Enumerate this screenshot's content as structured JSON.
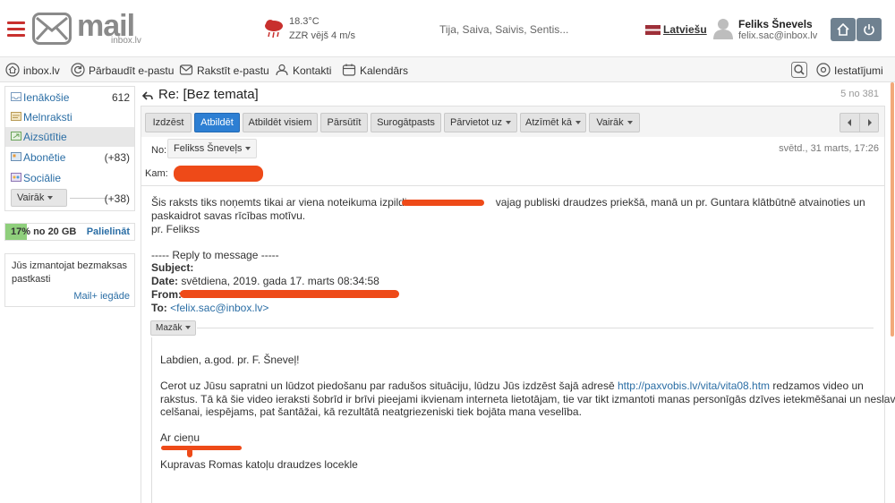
{
  "header": {
    "logo_text": "mail",
    "logo_sub": "inbox.lv",
    "weather_temp": "18.3°C",
    "weather_wind": "ZZR vējš 4 m/s",
    "namedays": "Tija, Saiva, Saivis, Sentis...",
    "language": "Latviešu",
    "user_name": "Feliks Šnevels",
    "user_email": "felix.sac@inbox.lv",
    "brand_color": "#c8302e"
  },
  "nav": {
    "items": [
      {
        "label": "inbox.lv",
        "icon": "home-icon"
      },
      {
        "label": "Pārbaudīt e-pastu",
        "icon": "refresh-icon"
      },
      {
        "label": "Rakstīt e-pastu",
        "icon": "compose-icon"
      },
      {
        "label": "Kontakti",
        "icon": "contacts-icon"
      },
      {
        "label": "Kalendārs",
        "icon": "calendar-icon"
      }
    ],
    "settings_label": "Iestatījumi"
  },
  "sidebar": {
    "folders": [
      {
        "name": "Ienākošie",
        "count": "612"
      },
      {
        "name": "Melnraksti",
        "count": ""
      },
      {
        "name": "Aizsūtītie",
        "count": ""
      },
      {
        "name": "Abonētie",
        "count": "(+83)"
      },
      {
        "name": "Sociālie",
        "count": ""
      }
    ],
    "more_label": "Vairāk",
    "more_count": "(+38)",
    "storage_text": "17% no 20 GB",
    "storage_percent": 17,
    "storage_link": "Palielināt",
    "promo_text": "Jūs izmantojat bezmaksas pastkasti",
    "promo_link": "Mail+ iegāde"
  },
  "message": {
    "subject": "Re: [Bez temata]",
    "counter": "5 no 381",
    "toolbar": {
      "delete": "Izdzēst",
      "reply": "Atbildēt",
      "reply_all": "Atbildēt visiem",
      "forward": "Pārsūtīt",
      "spam": "Surogātpasts",
      "move": "Pārvietot uz",
      "mark": "Atzīmēt kā",
      "more": "Vairāk"
    },
    "from_label": "No:",
    "from_name": "Felikss Šneveļs",
    "to_label": "Kam:",
    "date": "svētd., 31 marts, 17:26",
    "body": {
      "line1": "Šis raksts tiks noņemts tikai ar viena noteikuma izpildi -",
      "line1b": "vajag publiski draudzes priekšā, manā un pr. Guntara klātbūtnē atvainoties un",
      "line2": "paskaidrot savas rīcības motīvu.",
      "line3": "pr. Felikss",
      "reply_header": "----- Reply to message -----",
      "subject_label": "Subject:",
      "date_label": "Date:",
      "date_value": "svētdiena, 2019. gada 17. marts 08:34:58",
      "from_label": "From:",
      "to_label": "To:",
      "to_value": "<felix.sac@inbox.lv>",
      "less_label": "Mazāk",
      "q_greeting": "Labdien, a.god. pr. F. Šneveļ!",
      "q_p1a": "Cerot uz Jūsu sapratni un lūdzot piedošanu par radušos situāciju, lūdzu Jūs izdzēst šajā adresē",
      "q_p1_link": "http://paxvobis.lv/vita/vita08.htm",
      "q_p1b": "redzamos video un",
      "q_p2": "rakstus. Tā kā šie video ieraksti šobrīd ir brīvi pieejami ikvienam interneta lietotājam, tie var tikt izmantoti manas personīgās dzīves ietekmēšanai un neslavas",
      "q_p3": "celšanai, iespējams, pat šantāžai, kā rezultātā neatgriezeniski tiek bojāta mana veselība.",
      "q_closing": "Ar cieņu",
      "q_sig": "Kupravas Romas katoļu draudzes locekle"
    }
  }
}
